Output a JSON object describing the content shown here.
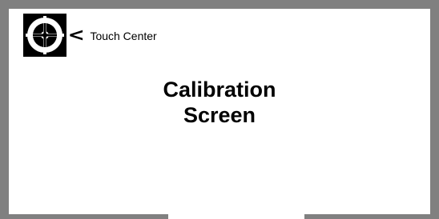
{
  "calibration": {
    "instruction": "Touch Center",
    "pointer_icon": "chevron-left-icon",
    "target_icon": "crosshair-target-icon",
    "title_line1": "Calibration",
    "title_line2": "Screen"
  },
  "colors": {
    "bezel": "#808080",
    "screen": "#ffffff",
    "ink": "#000000"
  }
}
